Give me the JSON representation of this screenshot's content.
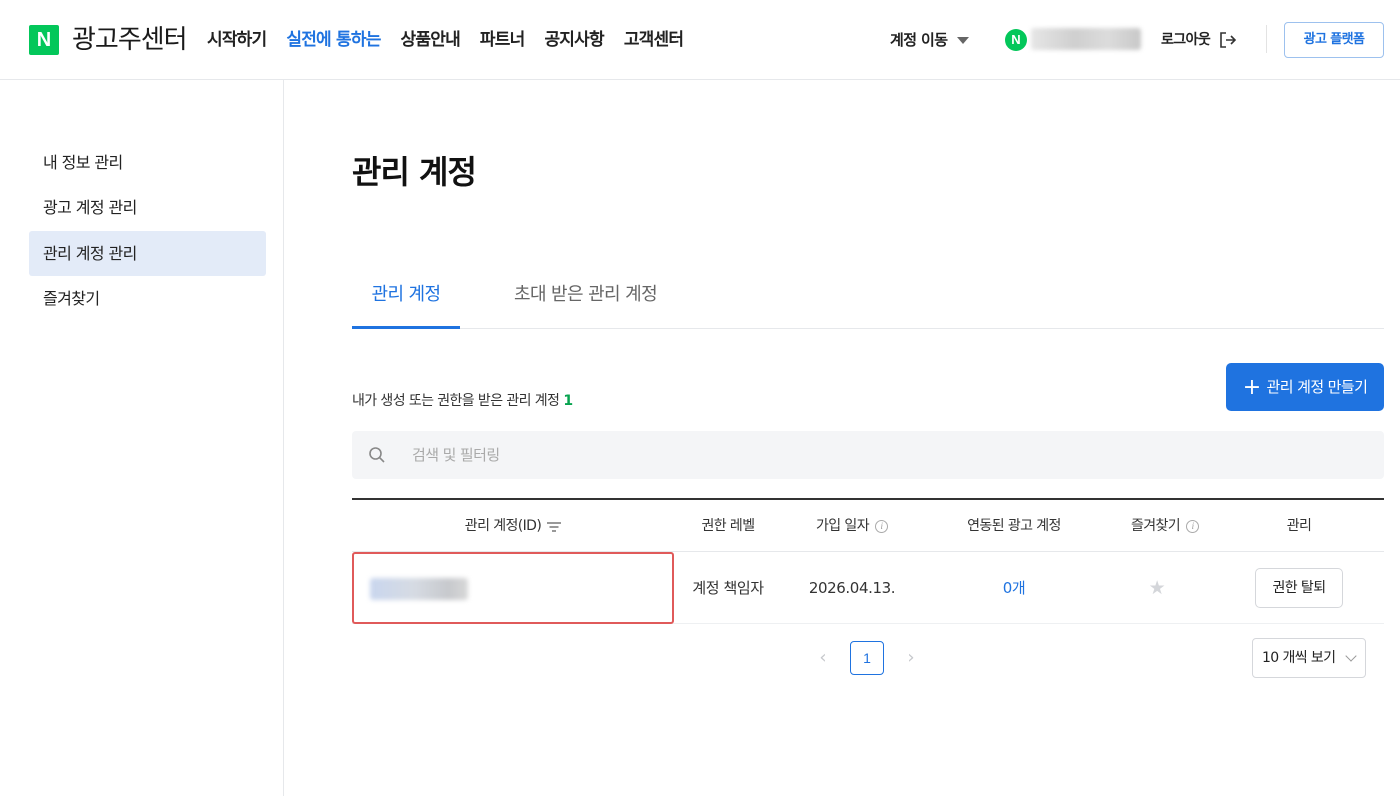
{
  "header": {
    "logo_mark": "N",
    "logo_text": "광고주센터",
    "nav": [
      "시작하기",
      "실전에 통하는",
      "상품안내",
      "파트너",
      "공지사항",
      "고객센터"
    ],
    "active_nav_index": 1,
    "account_move": "계정 이동",
    "user_mark": "N",
    "logout": "로그아웃",
    "platform_button": "광고 플랫폼"
  },
  "sidebar": {
    "items": [
      "내 정보 관리",
      "광고 계정 관리",
      "관리 계정 관리",
      "즐겨찾기"
    ],
    "active_index": 2
  },
  "main": {
    "title": "관리 계정",
    "tabs": [
      "관리 계정",
      "초대 받은 관리 계정"
    ],
    "summary_text": "내가 생성 또는 권한을 받은 관리 계정",
    "summary_count": "1",
    "create_button": "관리 계정 만들기",
    "search_placeholder": "검색 및 필터링",
    "table": {
      "headers": [
        "관리 계정(ID)",
        "권한 레벨",
        "가입 일자",
        "연동된 광고 계정",
        "즐겨찾기",
        "관리"
      ],
      "rows": [
        {
          "permission": "계정 책임자",
          "joined": "2026.04.13.",
          "linked": "0개",
          "action": "권한 탈퇴"
        }
      ]
    },
    "pagination": {
      "current": "1"
    },
    "per_page": "10 개씩 보기"
  },
  "colors": {
    "accent": "#1f73e0",
    "naver_green": "#03c75a",
    "count_green": "#07a34f",
    "highlight_red": "#e05a5a"
  }
}
